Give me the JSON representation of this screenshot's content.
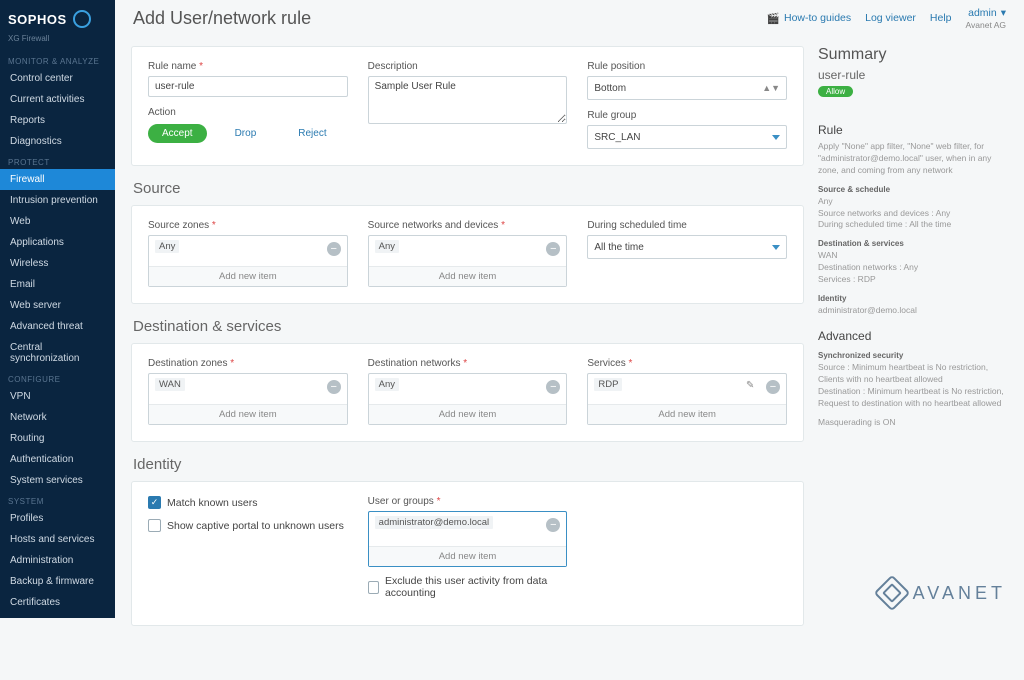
{
  "brand": {
    "name": "SOPHOS",
    "product": "XG Firewall"
  },
  "top": {
    "title": "Add User/network rule",
    "howto": "How-to guides",
    "log": "Log viewer",
    "help": "Help",
    "admin": "admin",
    "tenant": "Avanet AG"
  },
  "nav": {
    "monitor": {
      "h": "MONITOR & ANALYZE",
      "items": [
        "Control center",
        "Current activities",
        "Reports",
        "Diagnostics"
      ]
    },
    "protect": {
      "h": "PROTECT",
      "items": [
        "Firewall",
        "Intrusion prevention",
        "Web",
        "Applications",
        "Wireless",
        "Email",
        "Web server",
        "Advanced threat",
        "Central synchronization"
      ],
      "activeIndex": 0
    },
    "configure": {
      "h": "CONFIGURE",
      "items": [
        "VPN",
        "Network",
        "Routing",
        "Authentication",
        "System services"
      ]
    },
    "system": {
      "h": "SYSTEM",
      "items": [
        "Profiles",
        "Hosts and services",
        "Administration",
        "Backup & firmware",
        "Certificates"
      ]
    }
  },
  "form": {
    "ruleNameLabel": "Rule name",
    "ruleName": "user-rule",
    "descriptionLabel": "Description",
    "description": "Sample User Rule",
    "positionLabel": "Rule position",
    "position": "Bottom",
    "groupLabel": "Rule group",
    "group": "SRC_LAN",
    "actionLabel": "Action",
    "actions": {
      "accept": "Accept",
      "drop": "Drop",
      "reject": "Reject"
    }
  },
  "sections": {
    "source": "Source",
    "dest": "Destination & services",
    "identity": "Identity"
  },
  "source": {
    "zonesLabel": "Source zones",
    "zone": "Any",
    "netLabel": "Source networks and devices",
    "net": "Any",
    "schedLabel": "During scheduled time",
    "sched": "All the time"
  },
  "dest": {
    "zonesLabel": "Destination zones",
    "zone": "WAN",
    "netLabel": "Destination networks",
    "net": "Any",
    "svcLabel": "Services",
    "svc": "RDP"
  },
  "identity": {
    "matchKnown": "Match known users",
    "captive": "Show captive portal to unknown users",
    "usersLabel": "User or groups",
    "user": "administrator@demo.local",
    "exclude": "Exclude this user activity from data accounting"
  },
  "addNew": "Add new item",
  "summary": {
    "heading": "Summary",
    "name": "user-rule",
    "action": "Allow",
    "ruleH": "Rule",
    "ruleDesc": "Apply \"None\" app filter, \"None\" web filter, for \"administrator@demo.local\" user, when in any zone, and coming from any network",
    "srcSchedH": "Source & schedule",
    "srcSched1": "Any",
    "srcSched2": "Source networks and devices : Any",
    "srcSched3": "During scheduled time : All the time",
    "destSvcH": "Destination & services",
    "destSvc1": "WAN",
    "destSvc2": "Destination networks : Any",
    "destSvc3": "Services : RDP",
    "idH": "Identity",
    "id1": "administrator@demo.local",
    "advH": "Advanced",
    "syncH": "Synchronized security",
    "sync1": "Source : Minimum heartbeat is No restriction, Clients with no heartbeat allowed",
    "sync2": "Destination : Minimum heartbeat is No restriction, Request to destination with no heartbeat allowed",
    "masq": "Masquerading is ON"
  },
  "watermark": "AVANET"
}
